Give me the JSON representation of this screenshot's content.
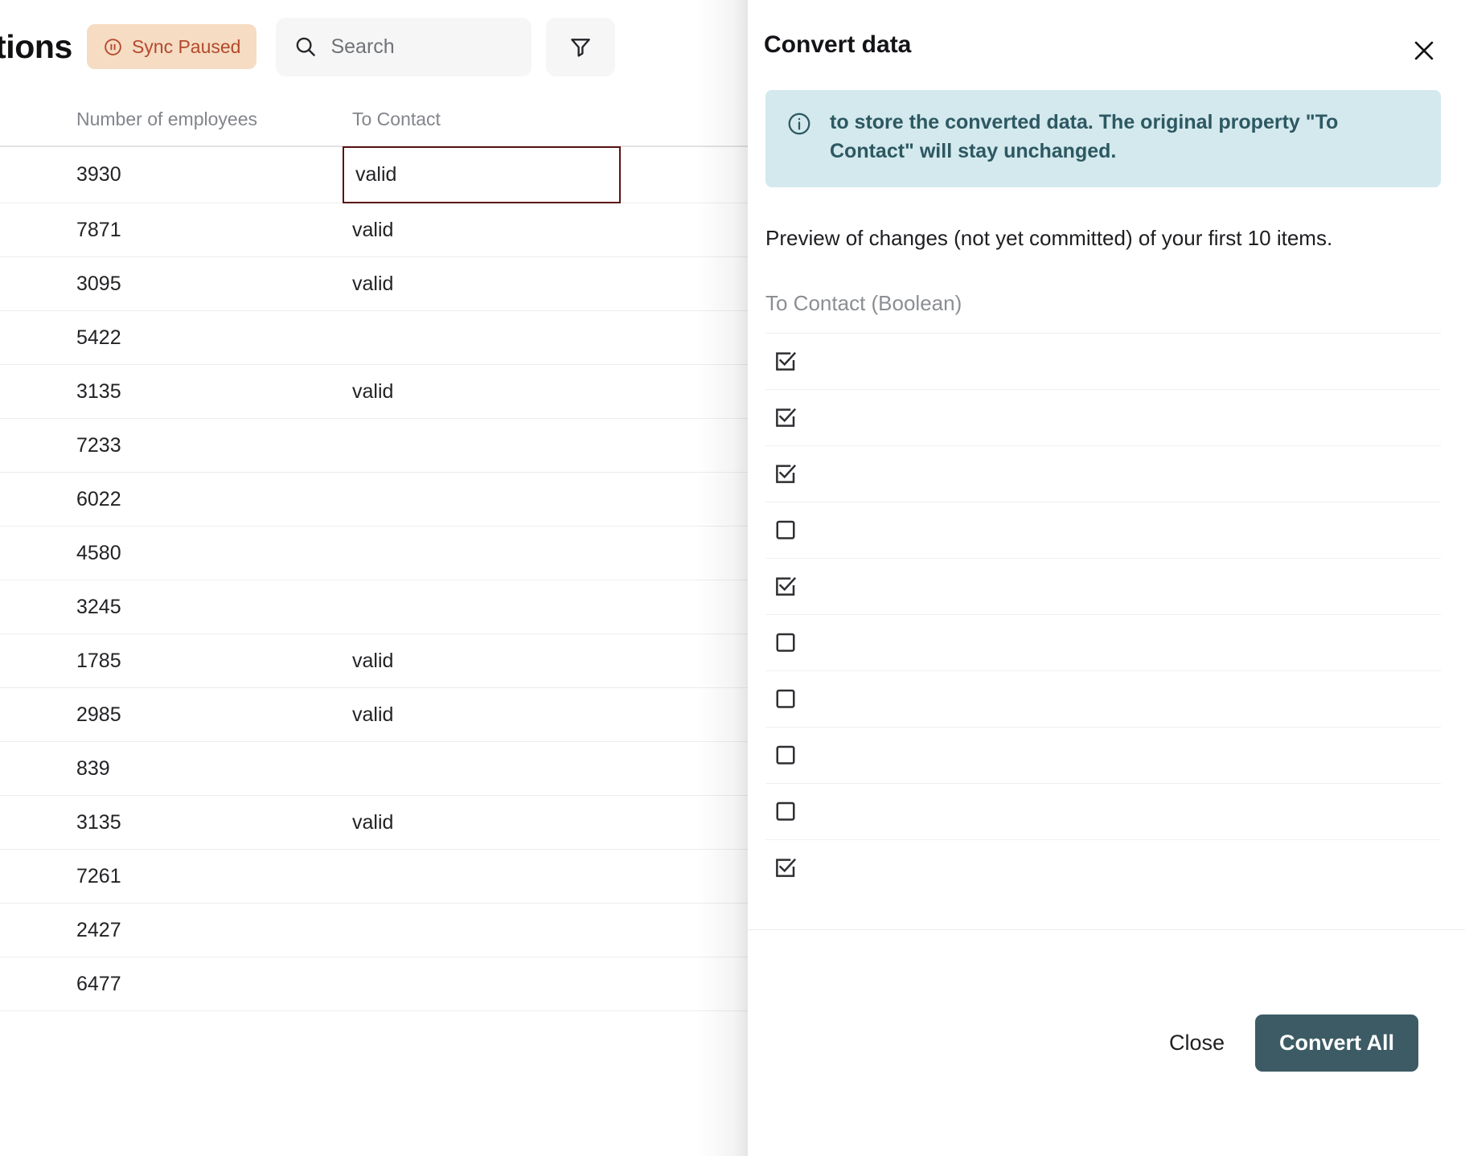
{
  "app": {
    "title_visible_fragment": "tions",
    "sync_badge": {
      "label": "Sync Paused",
      "icon": "pause-circle-icon",
      "bg": "#f5dcc3",
      "fg": "#b4492c"
    },
    "search": {
      "placeholder": "Search",
      "value": "",
      "icon": "search-icon"
    },
    "filter_button": {
      "icon": "filter-icon"
    }
  },
  "table": {
    "columns": [
      "Number of employees",
      "To Contact"
    ],
    "selected_cell": {
      "row_index": 0,
      "column": "To Contact",
      "value": "valid",
      "border_color": "#5a1313"
    },
    "rows": [
      {
        "employees": "3930",
        "to_contact": "valid"
      },
      {
        "employees": "7871",
        "to_contact": "valid"
      },
      {
        "employees": "3095",
        "to_contact": "valid"
      },
      {
        "employees": "5422",
        "to_contact": ""
      },
      {
        "employees": "3135",
        "to_contact": "valid"
      },
      {
        "employees": "7233",
        "to_contact": ""
      },
      {
        "employees": "6022",
        "to_contact": ""
      },
      {
        "employees": "4580",
        "to_contact": ""
      },
      {
        "employees": "3245",
        "to_contact": ""
      },
      {
        "employees": "1785",
        "to_contact": "valid"
      },
      {
        "employees": "2985",
        "to_contact": "valid"
      },
      {
        "employees": "839",
        "to_contact": ""
      },
      {
        "employees": "3135",
        "to_contact": "valid"
      },
      {
        "employees": "7261",
        "to_contact": ""
      },
      {
        "employees": "2427",
        "to_contact": ""
      },
      {
        "employees": "6477",
        "to_contact": ""
      }
    ]
  },
  "panel": {
    "title": "Convert data",
    "close_icon": "close-icon",
    "info": {
      "icon": "info-circle-icon",
      "text": "to store the converted data. The original property \"To Contact\" will stay unchanged.",
      "bg": "#d3e9ed",
      "fg": "#2d5862"
    },
    "preview_note": "Preview of changes (not yet committed) of your first 10 items.",
    "property_label": "To Contact (Boolean)",
    "preview_rows": [
      {
        "checked": true
      },
      {
        "checked": true
      },
      {
        "checked": true
      },
      {
        "checked": false
      },
      {
        "checked": true
      },
      {
        "checked": false
      },
      {
        "checked": false
      },
      {
        "checked": false
      },
      {
        "checked": false
      },
      {
        "checked": true
      }
    ],
    "footer": {
      "close_label": "Close",
      "convert_label": "Convert All",
      "primary_color": "#3c5b64"
    }
  }
}
